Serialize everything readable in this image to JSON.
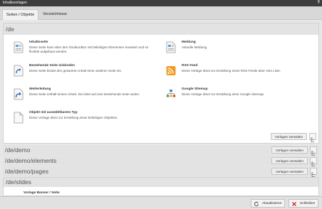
{
  "window": {
    "title": "Inhaltsvorlagen",
    "help": "?"
  },
  "tabs": [
    {
      "label": "Seiten / Objekte",
      "active": true
    },
    {
      "label": "Verzeichnisse",
      "active": false
    }
  ],
  "groups": {
    "de": {
      "path": "/de",
      "manage_label": "Vorlagen verwalten",
      "templates": [
        {
          "title": "Inhaltsseite",
          "desc": "Diese Seite kann über den Strukturditor mit beliebigen Elementen erweitert und so flexibel aufgebaut werden.",
          "icon": "page-icon"
        },
        {
          "title": "Meldung",
          "desc": "Aktuelle Meldung",
          "icon": "page-icon"
        },
        {
          "title": "Bestehende Seite einbinden",
          "desc": "Diese Seite bindet den gesamten Inhalt einer anderen Seite ein.",
          "icon": "page-link-icon"
        },
        {
          "title": "RSS Feed",
          "desc": "Diese Vorlage dient zur Erstellung eines RSS-Feeds über eine Liste.",
          "icon": "rss-icon"
        },
        {
          "title": "Weiterleitung",
          "desc": "Diese Seite enthält keinen Inhalt. Sie leitet auf eine bestehende Seite weiter.",
          "icon": "redirect-icon"
        },
        {
          "title": "Google Sitemap",
          "desc": "Diese Vorlage dient zur Erstellung einer Google Sitemap.",
          "icon": "sitemap-icon"
        },
        {
          "title": "Objekt mit auswählbarem Typ",
          "desc": "Diese Vorlage dient zur Erstellung eines beliebigen Objektes.",
          "icon": "blank-page-icon"
        }
      ]
    },
    "collapsed": [
      {
        "path": "/de/demo",
        "manage_label": "Vorlagen verwalten"
      },
      {
        "path": "/de/demo/elements",
        "manage_label": "Vorlagen verwalten"
      },
      {
        "path": "/de/demo/pages",
        "manage_label": "Vorlagen verwalten"
      }
    ],
    "slides": {
      "path": "/de/slides",
      "partial_title": "Vorlage Banner / Seite"
    }
  },
  "footer": {
    "refresh_label": "Aktualisieren",
    "close_label": "Schließen"
  },
  "colors": {
    "titlebar": "#3d3d3d",
    "rss": "#f29a24",
    "arrow": "#2f6fb5",
    "close_x": "#d02a2a",
    "header_bg": "#e3e3e3"
  }
}
